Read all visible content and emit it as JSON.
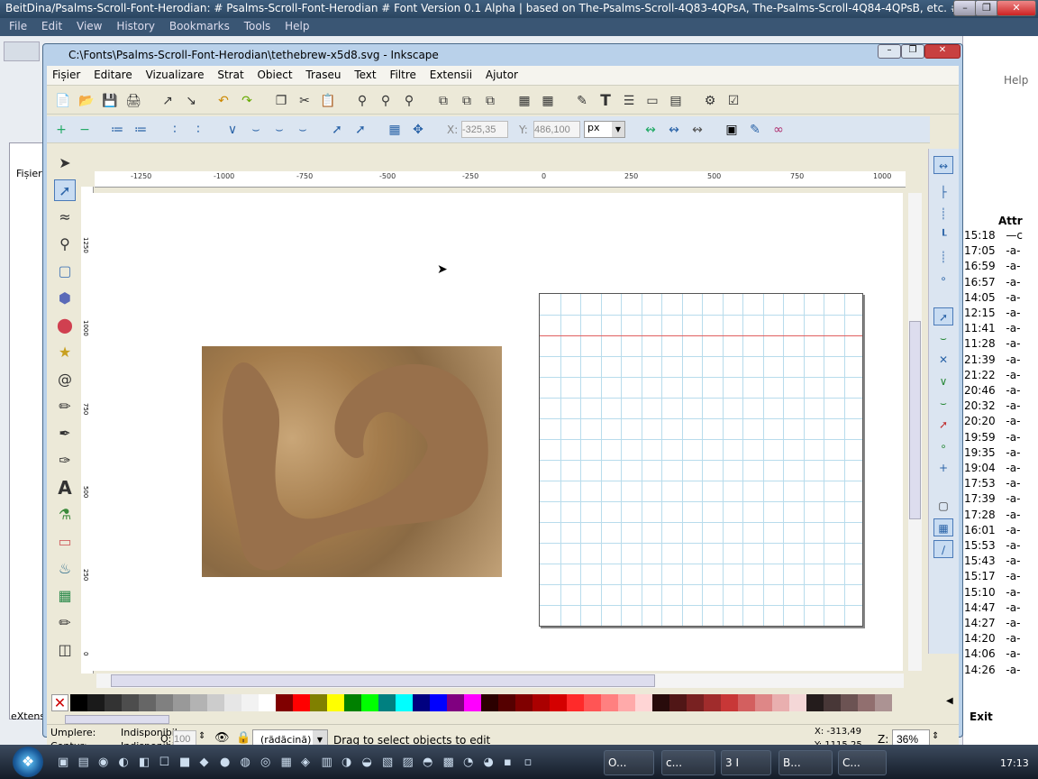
{
  "firefox": {
    "title": "BeitDina/Psalms-Scroll-Font-Herodian: # Psalms-Scroll-Font-Herodian # Font Version 0.1 Alpha | based on The-Psalms-Scroll-4Q83-4QPsA, The-Psalms-Scroll-4Q84-4QPsB, etc. # This font co...",
    "menu": [
      "File",
      "Edit",
      "View",
      "History",
      "Bookmarks",
      "Tools",
      "Help"
    ],
    "help_label": "Help",
    "right_col_headers": [
      "Attr"
    ],
    "times": [
      "15:18",
      "17:05",
      "16:59",
      "16:57",
      "14:05",
      "12:15",
      "11:41",
      "11:28",
      "21:39",
      "21:22",
      "20:46",
      "20:32",
      "20:20",
      "19:59",
      "19:35",
      "19:04",
      "17:53",
      "17:39",
      "17:28",
      "16:01",
      "15:53",
      "15:43",
      "15:17",
      "15:10",
      "14:47",
      "14:27",
      "14:20",
      "14:06",
      "14:26"
    ],
    "attrs": [
      "—c",
      "-a-",
      "-a-",
      "-a-",
      "-a-",
      "-a-",
      "-a-",
      "-a-",
      "-a-",
      "-a-",
      "-a-",
      "-a-",
      "-a-",
      "-a-",
      "-a-",
      "-a-",
      "-a-",
      "-a-",
      "-a-",
      "-a-",
      "-a-",
      "-a-",
      "-a-",
      "-a-",
      "-a-",
      "-a-",
      "-a-",
      "-a-",
      "-a-"
    ],
    "exit_label": "Exit",
    "extens_label": "eXtens",
    "fisier_label": "Fișier"
  },
  "inkscape": {
    "title": "C:\\Fonts\\Psalms-Scroll-Font-Herodian\\tethebrew-x5d8.svg - Inkscape",
    "menu": [
      "Fișier",
      "Editare",
      "Vizualizare",
      "Strat",
      "Obiect",
      "Traseu",
      "Text",
      "Filtre",
      "Extensii",
      "Ajutor"
    ],
    "x_label": "X:",
    "x_value": "-325,35",
    "y_label": "Y:",
    "y_value": "486,100",
    "unit": "px",
    "ruler_labels": [
      "-1250",
      "-1000",
      "-750",
      "-500",
      "-250",
      "0",
      "250",
      "500",
      "750",
      "1000"
    ],
    "vruler_labels": [
      "1250",
      "1000",
      "750",
      "500",
      "250",
      "0"
    ],
    "fill_label": "Umplere:",
    "fill_value": "Indisponibil",
    "stroke_label": "Contur:",
    "stroke_value": "Indisponibil",
    "opacity_label": "O:",
    "opacity_value": "100",
    "layer_value": "(rădăcină)",
    "status_message": "Drag to select objects to edit",
    "cursor_x": "X: -313,49",
    "cursor_y": "Y: 1115,25",
    "zoom_label": "Z:",
    "zoom_value": "36%"
  },
  "palette": [
    "#000000",
    "#1a1a1a",
    "#333333",
    "#4d4d4d",
    "#666666",
    "#808080",
    "#999999",
    "#b3b3b3",
    "#cccccc",
    "#e6e6e6",
    "#f2f2f2",
    "#ffffff",
    "#800000",
    "#ff0000",
    "#808000",
    "#ffff00",
    "#008000",
    "#00ff00",
    "#008080",
    "#00ffff",
    "#000080",
    "#0000ff",
    "#800080",
    "#ff00ff",
    "#2b0000",
    "#550000",
    "#800000",
    "#aa0000",
    "#d40000",
    "#ff2a2a",
    "#ff5555",
    "#ff8080",
    "#ffaaaa",
    "#ffd5d5",
    "#280b0b",
    "#501616",
    "#782121",
    "#a02c2c",
    "#c83737",
    "#d35f5f",
    "#de8787",
    "#e9afaf",
    "#f4d7d7",
    "#241c1c",
    "#483737",
    "#6c5353",
    "#916f6f",
    "#ac9393"
  ],
  "taskbar": {
    "tasks": [
      "O...",
      "c...",
      "3 I",
      "B...",
      "C..."
    ],
    "clock": "17:13"
  },
  "colors": {
    "glyph": "#98704b",
    "grid": "#b8dcec",
    "guide": "#e06060"
  }
}
